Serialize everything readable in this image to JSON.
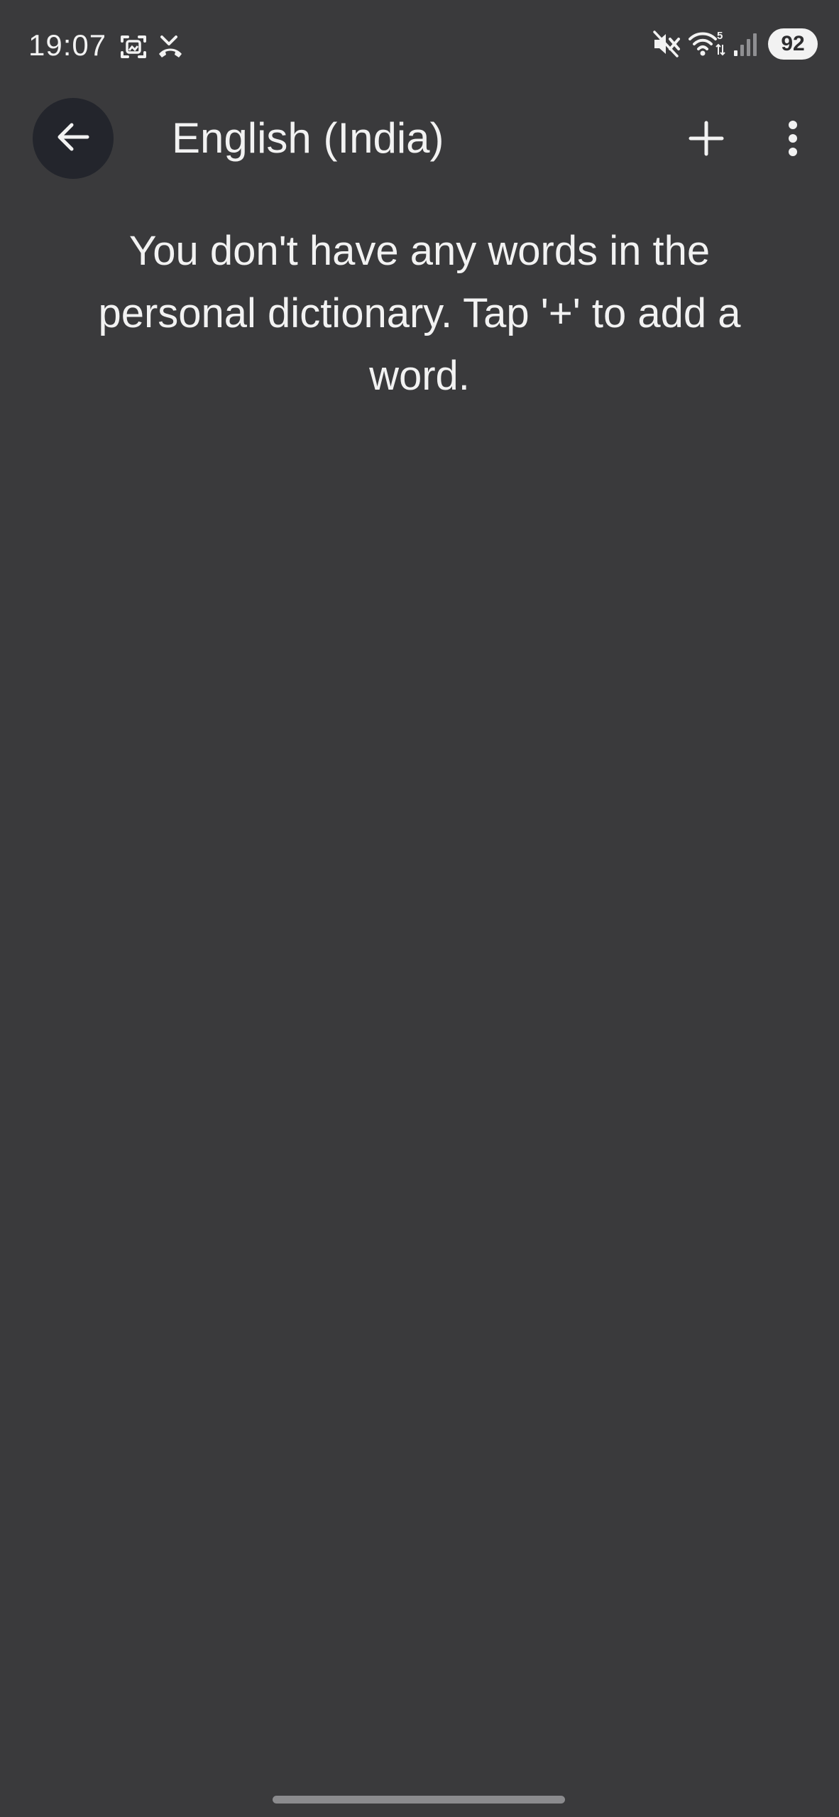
{
  "status_bar": {
    "time": "19:07",
    "battery_level": "92",
    "wifi_label": "5",
    "icons": [
      "screenshot-icon",
      "missed-call-icon",
      "mute-icon",
      "wifi-icon",
      "signal-icon",
      "battery-icon"
    ]
  },
  "app_bar": {
    "title": "English (India)",
    "icons": [
      "back-arrow-icon",
      "plus-icon",
      "more-vert-icon"
    ]
  },
  "content": {
    "empty_message": "You don't have any words in the personal dictionary. Tap '+' to add a word."
  },
  "colors": {
    "background": "#3a3a3c",
    "text": "#f2f2f2",
    "back_button_bg": "#23252c",
    "nav_handle": "#8b8b8e"
  }
}
